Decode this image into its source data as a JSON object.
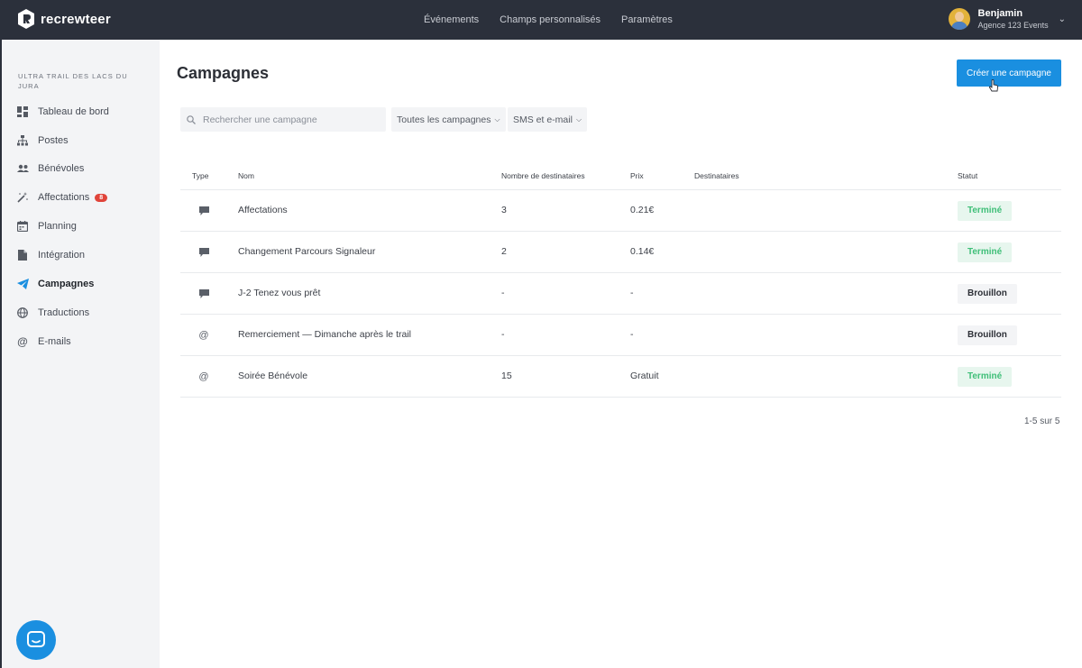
{
  "brand": {
    "name": "recrewteer"
  },
  "topnav": {
    "items": [
      "Événements",
      "Champs personnalisés",
      "Paramètres"
    ]
  },
  "user": {
    "name": "Benjamin",
    "org": "Agence 123 Events"
  },
  "sidebar": {
    "event_name": "ULTRA TRAIL DES LACS DU JURA",
    "items": [
      {
        "label": "Tableau de bord",
        "icon": "dashboard-icon"
      },
      {
        "label": "Postes",
        "icon": "sitemap-icon"
      },
      {
        "label": "Bénévoles",
        "icon": "users-icon"
      },
      {
        "label": "Affectations",
        "icon": "magic-wand-icon",
        "badge": "8"
      },
      {
        "label": "Planning",
        "icon": "calendar-icon"
      },
      {
        "label": "Intégration",
        "icon": "document-icon"
      },
      {
        "label": "Campagnes",
        "icon": "paper-plane-icon",
        "active": true
      },
      {
        "label": "Traductions",
        "icon": "globe-icon"
      },
      {
        "label": "E-mails",
        "icon": "at-icon"
      }
    ]
  },
  "page": {
    "title": "Campagnes",
    "create_label": "Créer une campagne",
    "search_placeholder": "Rechercher une campagne",
    "filter_campaigns": "Toutes les campagnes",
    "filter_channel": "SMS et e-mail",
    "pagination": "1-5 sur 5"
  },
  "table": {
    "columns": [
      "Type",
      "Nom",
      "Nombre de destinataires",
      "Prix",
      "Destinataires",
      "Statut"
    ],
    "rows": [
      {
        "type": "sms",
        "name": "Affectations",
        "recipients": "3",
        "price": "0.21€",
        "status": "Terminé",
        "status_kind": "done"
      },
      {
        "type": "sms",
        "name": "Changement Parcours Signaleur",
        "recipients": "2",
        "price": "0.14€",
        "status": "Terminé",
        "status_kind": "done"
      },
      {
        "type": "sms",
        "name": "J-2 Tenez vous prêt",
        "recipients": "-",
        "price": "-",
        "status": "Brouillon",
        "status_kind": "draft"
      },
      {
        "type": "email",
        "name": "Remerciement — Dimanche après le trail",
        "recipients": "-",
        "price": "-",
        "status": "Brouillon",
        "status_kind": "draft"
      },
      {
        "type": "email",
        "name": "Soirée Bénévole",
        "recipients": "15",
        "price": "Gratuit",
        "status": "Terminé",
        "status_kind": "done"
      }
    ]
  },
  "colors": {
    "topbar": "#2b303b",
    "accent": "#1a8fe0",
    "done_bg": "#e7f6ee",
    "done_text": "#3fbf78",
    "badge": "#e0443a"
  }
}
